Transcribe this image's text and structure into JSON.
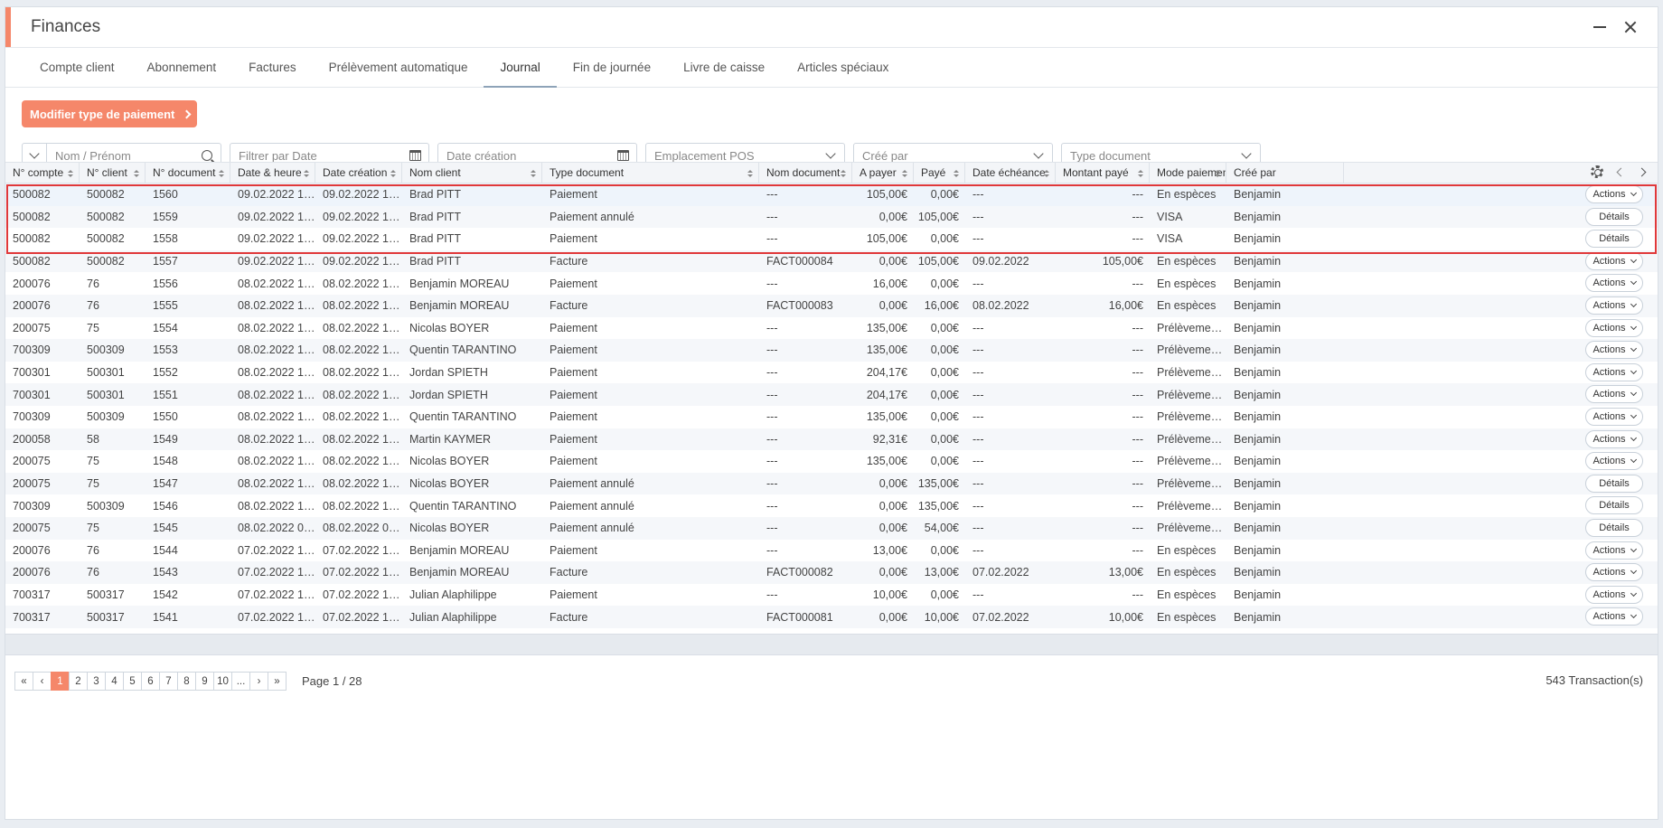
{
  "window": {
    "title": "Finances"
  },
  "tabs": [
    {
      "label": "Compte client",
      "active": false
    },
    {
      "label": "Abonnement",
      "active": false
    },
    {
      "label": "Factures",
      "active": false
    },
    {
      "label": "Prélèvement automatique",
      "active": false
    },
    {
      "label": "Journal",
      "active": true
    },
    {
      "label": "Fin de journée",
      "active": false
    },
    {
      "label": "Livre de caisse",
      "active": false
    },
    {
      "label": "Articles spéciaux",
      "active": false
    }
  ],
  "toolbar": {
    "modify_payment_type": "Modifier type de paiement"
  },
  "filters": {
    "name_placeholder": "Nom / Prénom",
    "date_placeholder": "Filtrer par Date",
    "creation_placeholder": "Date création",
    "pos_placeholder": "Emplacement POS",
    "created_by_placeholder": "Créé par",
    "doc_type_placeholder": "Type document"
  },
  "columns": [
    "N° compte",
    "N° client",
    "N° document",
    "Date & heure",
    "Date création",
    "Nom client",
    "Type document",
    "Nom document",
    "A payer",
    "Payé",
    "Date échéance",
    "Montant payé",
    "Mode paiement",
    "Créé par"
  ],
  "rows": [
    {
      "compte": "500082",
      "client": "500082",
      "doc": "1560",
      "date": "09.02.2022 10:...",
      "creation": "09.02.2022 10:...",
      "nom": "Brad PITT",
      "type": "Paiement",
      "nomdoc": "---",
      "apayer": "105,00€",
      "paye": "0,00€",
      "echeance": "---",
      "montant": "---",
      "mode": "En espèces",
      "cree": "Benjamin",
      "btn": "Actions"
    },
    {
      "compte": "500082",
      "client": "500082",
      "doc": "1559",
      "date": "09.02.2022 10:...",
      "creation": "09.02.2022 10:...",
      "nom": "Brad PITT",
      "type": "Paiement annulé",
      "nomdoc": "---",
      "apayer": "0,00€",
      "paye": "105,00€",
      "echeance": "---",
      "montant": "---",
      "mode": "VISA",
      "cree": "Benjamin",
      "btn": "Détails"
    },
    {
      "compte": "500082",
      "client": "500082",
      "doc": "1558",
      "date": "09.02.2022 10:...",
      "creation": "09.02.2022 10:...",
      "nom": "Brad PITT",
      "type": "Paiement",
      "nomdoc": "---",
      "apayer": "105,00€",
      "paye": "0,00€",
      "echeance": "---",
      "montant": "---",
      "mode": "VISA",
      "cree": "Benjamin",
      "btn": "Détails"
    },
    {
      "compte": "500082",
      "client": "500082",
      "doc": "1557",
      "date": "09.02.2022 10:...",
      "creation": "09.02.2022 10:...",
      "nom": "Brad PITT",
      "type": "Facture",
      "nomdoc": "FACT000084",
      "apayer": "0,00€",
      "paye": "105,00€",
      "echeance": "09.02.2022",
      "montant": "105,00€",
      "mode": "En espèces",
      "cree": "Benjamin",
      "btn": "Actions"
    },
    {
      "compte": "200076",
      "client": "76",
      "doc": "1556",
      "date": "08.02.2022 13:...",
      "creation": "08.02.2022 13:...",
      "nom": "Benjamin MOREAU",
      "type": "Paiement",
      "nomdoc": "---",
      "apayer": "16,00€",
      "paye": "0,00€",
      "echeance": "---",
      "montant": "---",
      "mode": "En espèces",
      "cree": "Benjamin",
      "btn": "Actions"
    },
    {
      "compte": "200076",
      "client": "76",
      "doc": "1555",
      "date": "08.02.2022 13:...",
      "creation": "08.02.2022 13:...",
      "nom": "Benjamin MOREAU",
      "type": "Facture",
      "nomdoc": "FACT000083",
      "apayer": "0,00€",
      "paye": "16,00€",
      "echeance": "08.02.2022",
      "montant": "16,00€",
      "mode": "En espèces",
      "cree": "Benjamin",
      "btn": "Actions"
    },
    {
      "compte": "200075",
      "client": "75",
      "doc": "1554",
      "date": "08.02.2022 13:...",
      "creation": "08.02.2022 13:...",
      "nom": "Nicolas BOYER",
      "type": "Paiement",
      "nomdoc": "---",
      "apayer": "135,00€",
      "paye": "0,00€",
      "echeance": "---",
      "montant": "---",
      "mode": "Prélèvement...",
      "cree": "Benjamin",
      "btn": "Actions"
    },
    {
      "compte": "700309",
      "client": "500309",
      "doc": "1553",
      "date": "08.02.2022 13:...",
      "creation": "08.02.2022 13:...",
      "nom": "Quentin TARANTINO",
      "type": "Paiement",
      "nomdoc": "---",
      "apayer": "135,00€",
      "paye": "0,00€",
      "echeance": "---",
      "montant": "---",
      "mode": "Prélèvement...",
      "cree": "Benjamin",
      "btn": "Actions"
    },
    {
      "compte": "700301",
      "client": "500301",
      "doc": "1552",
      "date": "08.02.2022 13:...",
      "creation": "08.02.2022 13:...",
      "nom": "Jordan SPIETH",
      "type": "Paiement",
      "nomdoc": "---",
      "apayer": "204,17€",
      "paye": "0,00€",
      "echeance": "---",
      "montant": "---",
      "mode": "Prélèvement...",
      "cree": "Benjamin",
      "btn": "Actions"
    },
    {
      "compte": "700301",
      "client": "500301",
      "doc": "1551",
      "date": "08.02.2022 13:...",
      "creation": "08.02.2022 13:...",
      "nom": "Jordan SPIETH",
      "type": "Paiement",
      "nomdoc": "---",
      "apayer": "204,17€",
      "paye": "0,00€",
      "echeance": "---",
      "montant": "---",
      "mode": "Prélèvement...",
      "cree": "Benjamin",
      "btn": "Actions"
    },
    {
      "compte": "700309",
      "client": "500309",
      "doc": "1550",
      "date": "08.02.2022 13:...",
      "creation": "08.02.2022 13:...",
      "nom": "Quentin TARANTINO",
      "type": "Paiement",
      "nomdoc": "---",
      "apayer": "135,00€",
      "paye": "0,00€",
      "echeance": "---",
      "montant": "---",
      "mode": "Prélèvement...",
      "cree": "Benjamin",
      "btn": "Actions"
    },
    {
      "compte": "200058",
      "client": "58",
      "doc": "1549",
      "date": "08.02.2022 13:...",
      "creation": "08.02.2022 13:...",
      "nom": "Martin KAYMER",
      "type": "Paiement",
      "nomdoc": "---",
      "apayer": "92,31€",
      "paye": "0,00€",
      "echeance": "---",
      "montant": "---",
      "mode": "Prélèvement...",
      "cree": "Benjamin",
      "btn": "Actions"
    },
    {
      "compte": "200075",
      "client": "75",
      "doc": "1548",
      "date": "08.02.2022 13:...",
      "creation": "08.02.2022 13:...",
      "nom": "Nicolas BOYER",
      "type": "Paiement",
      "nomdoc": "---",
      "apayer": "135,00€",
      "paye": "0,00€",
      "echeance": "---",
      "montant": "---",
      "mode": "Prélèvement...",
      "cree": "Benjamin",
      "btn": "Actions"
    },
    {
      "compte": "200075",
      "client": "75",
      "doc": "1547",
      "date": "08.02.2022 12:...",
      "creation": "08.02.2022 12:...",
      "nom": "Nicolas BOYER",
      "type": "Paiement annulé",
      "nomdoc": "---",
      "apayer": "0,00€",
      "paye": "135,00€",
      "echeance": "---",
      "montant": "---",
      "mode": "Prélèvement...",
      "cree": "Benjamin",
      "btn": "Détails"
    },
    {
      "compte": "700309",
      "client": "500309",
      "doc": "1546",
      "date": "08.02.2022 12:...",
      "creation": "08.02.2022 12:...",
      "nom": "Quentin TARANTINO",
      "type": "Paiement annulé",
      "nomdoc": "---",
      "apayer": "0,00€",
      "paye": "135,00€",
      "echeance": "---",
      "montant": "---",
      "mode": "Prélèvement...",
      "cree": "Benjamin",
      "btn": "Détails"
    },
    {
      "compte": "200075",
      "client": "75",
      "doc": "1545",
      "date": "08.02.2022 09:...",
      "creation": "08.02.2022 09:...",
      "nom": "Nicolas BOYER",
      "type": "Paiement annulé",
      "nomdoc": "---",
      "apayer": "0,00€",
      "paye": "54,00€",
      "echeance": "---",
      "montant": "---",
      "mode": "Prélèvement...",
      "cree": "Benjamin",
      "btn": "Détails"
    },
    {
      "compte": "200076",
      "client": "76",
      "doc": "1544",
      "date": "07.02.2022 16:...",
      "creation": "07.02.2022 16:...",
      "nom": "Benjamin MOREAU",
      "type": "Paiement",
      "nomdoc": "---",
      "apayer": "13,00€",
      "paye": "0,00€",
      "echeance": "---",
      "montant": "---",
      "mode": "En espèces",
      "cree": "Benjamin",
      "btn": "Actions"
    },
    {
      "compte": "200076",
      "client": "76",
      "doc": "1543",
      "date": "07.02.2022 16:...",
      "creation": "07.02.2022 16:...",
      "nom": "Benjamin MOREAU",
      "type": "Facture",
      "nomdoc": "FACT000082",
      "apayer": "0,00€",
      "paye": "13,00€",
      "echeance": "07.02.2022",
      "montant": "13,00€",
      "mode": "En espèces",
      "cree": "Benjamin",
      "btn": "Actions"
    },
    {
      "compte": "700317",
      "client": "500317",
      "doc": "1542",
      "date": "07.02.2022 14:...",
      "creation": "07.02.2022 14:...",
      "nom": "Julian Alaphilippe",
      "type": "Paiement",
      "nomdoc": "---",
      "apayer": "10,00€",
      "paye": "0,00€",
      "echeance": "---",
      "montant": "---",
      "mode": "En espèces",
      "cree": "Benjamin",
      "btn": "Actions"
    },
    {
      "compte": "700317",
      "client": "500317",
      "doc": "1541",
      "date": "07.02.2022 14:...",
      "creation": "07.02.2022 14:...",
      "nom": "Julian Alaphilippe",
      "type": "Facture",
      "nomdoc": "FACT000081",
      "apayer": "0,00€",
      "paye": "10,00€",
      "echeance": "07.02.2022",
      "montant": "10,00€",
      "mode": "En espèces",
      "cree": "Benjamin",
      "btn": "Actions"
    }
  ],
  "pagination": {
    "pages": [
      "«",
      "‹",
      "1",
      "2",
      "3",
      "4",
      "5",
      "6",
      "7",
      "8",
      "9",
      "10",
      "...",
      "›",
      "»"
    ],
    "current": "1",
    "page_info": "Page 1 / 28",
    "total": "543 Transaction(s)"
  },
  "colors": {
    "accent": "#f5876a",
    "highlight_border": "#e0383a"
  }
}
